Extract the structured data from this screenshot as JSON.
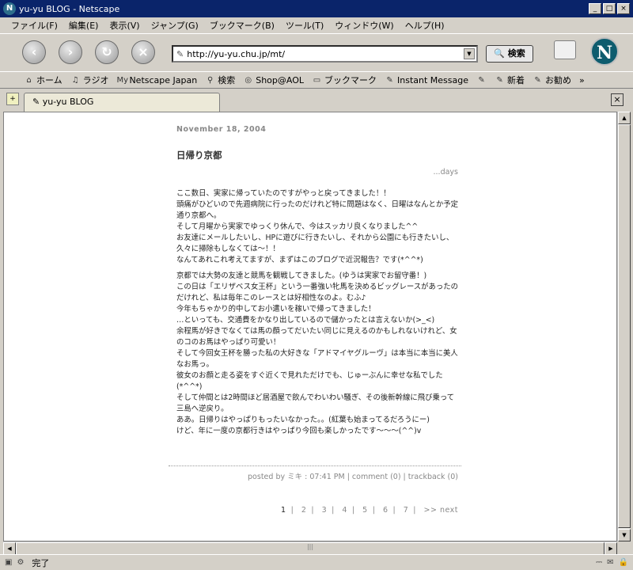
{
  "window": {
    "title": "yu-yu BLOG - Netscape",
    "app_icon": "N",
    "buttons": [
      "minimize",
      "maximize",
      "close"
    ]
  },
  "menu": [
    "ファイル(F)",
    "編集(E)",
    "表示(V)",
    "ジャンプ(G)",
    "ブックマーク(B)",
    "ツール(T)",
    "ウィンドウ(W)",
    "ヘルプ(H)"
  ],
  "navigation": {
    "url": "http://yu-yu.chu.jp/mt/",
    "search_button": "検索",
    "logo_letter": "N"
  },
  "personal_toolbar": {
    "items": [
      {
        "icon": "home-icon",
        "label": "ホーム"
      },
      {
        "icon": "radio-icon",
        "label": "ラジオ"
      },
      {
        "icon": "my-icon",
        "label": "Netscape Japan"
      },
      {
        "icon": "search-icon",
        "label": "検索"
      },
      {
        "icon": "shop-icon",
        "label": "Shop@AOL"
      },
      {
        "icon": "folder-icon",
        "label": "ブックマーク"
      },
      {
        "icon": "bookmark-icon",
        "label": "Instant Message"
      },
      {
        "icon": "bookmark-icon",
        "label": ""
      },
      {
        "icon": "bookmark-icon",
        "label": "新着"
      },
      {
        "icon": "bookmark-icon",
        "label": "お勧め"
      }
    ],
    "overflow": "»"
  },
  "tabs": [
    {
      "label": "yu-yu BLOG",
      "active": true
    }
  ],
  "blog": {
    "date": "November 18, 2004",
    "post_title": "日帰り京都",
    "category": "...days",
    "paragraphs": [
      "ここ数日、実家に帰っていたのですがやっと戻ってきました！！\n頭痛がひどいので先週病院に行ったのだけれど特に問題はなく、日曜はなんとか予定通り京都へ。\nそして月曜から実家でゆっくり休んで、今はスッカリ良くなりました^^\nお友達にメールしたいし、HPに遊びに行きたいし、それから公園にも行きたいし、久々に掃除もしなくては～！！\nなんてあれこれ考えてますが、まずはこのブログで近況報告？です(*^^*)",
      "京都では大勢の友達と競馬を観戦してきました。(ゆうは実家でお留守番！)\nこの日は「エリザベス女王杯」という一番強い牝馬を決めるビッグレースがあったのだけれど、私は毎年このレースとは好相性なのよ。むふ♪\n今年もちゃかり的中してお小遣いを稼いで帰ってきました！\n…といっても、交通費をかなり出しているので儲かったとは言えないか(>_<)\n余程馬が好きでなくては馬の顔ってだいたい同じに見えるのかもしれないけれど、女のコのお馬はやっぱり可愛い！\nそして今回女王杯を勝った私の大好きな「アドマイヤグルーヴ」は本当に本当に美人なお馬っ。\n彼女のお顔と走る姿をすぐ近くで見れただけでも、じゅーぶんに幸せな私でした(*^^*)\nそして仲間とは2時間ほど居酒屋で飲んでわいわい騒ぎ、その後新幹線に飛び乗って三島へ逆戻り。\nああ。日帰りはやっぱりもったいなかった。。(紅葉も始まってるだろうにー)\nけど、年に一度の京都行きはやっぱり今回も楽しかったです～～～(^^)v"
    ],
    "footer": "posted by ミキ : 07:41 PM | comment (0) | trackback (0)",
    "pager": {
      "pages": [
        "1",
        "2",
        "3",
        "4",
        "5",
        "6",
        "7"
      ],
      "current": "1",
      "next": ">> next"
    }
  },
  "status": {
    "text": "完了"
  }
}
